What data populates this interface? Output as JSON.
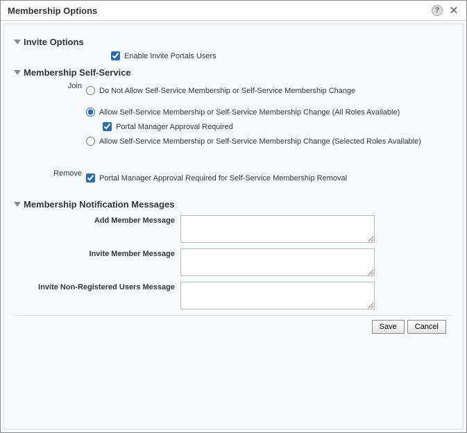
{
  "dialog": {
    "title": "Membership Options"
  },
  "sections": {
    "invite": {
      "heading": "Invite Options",
      "enable_invite_label": "Enable Invite Portals Users",
      "enable_invite_checked": true
    },
    "self_service": {
      "heading": "Membership Self-Service",
      "join_label": "Join",
      "join_options": {
        "opt1": "Do Not Allow Self-Service Membership or Self-Service Membership Change",
        "opt2": "Allow Self-Service Membership or Self-Service Membership Change (All Roles Available)",
        "opt2_sub": "Portal Manager Approval Required",
        "opt2_sub_checked": true,
        "opt3": "Allow Self-Service Membership or Self-Service Membership Change (Selected Roles Available)",
        "selected": "opt2"
      },
      "remove_label": "Remove",
      "remove_approval_label": "Portal Manager Approval Required for Self-Service Membership Removal",
      "remove_approval_checked": true
    },
    "notifications": {
      "heading": "Membership Notification Messages",
      "add_member_label": "Add Member Message",
      "add_member_value": "",
      "invite_member_label": "Invite Member Message",
      "invite_member_value": "",
      "invite_nonreg_label": "Invite Non-Registered Users Message",
      "invite_nonreg_value": ""
    }
  },
  "footer": {
    "save_label": "Save",
    "cancel_label": "Cancel"
  }
}
